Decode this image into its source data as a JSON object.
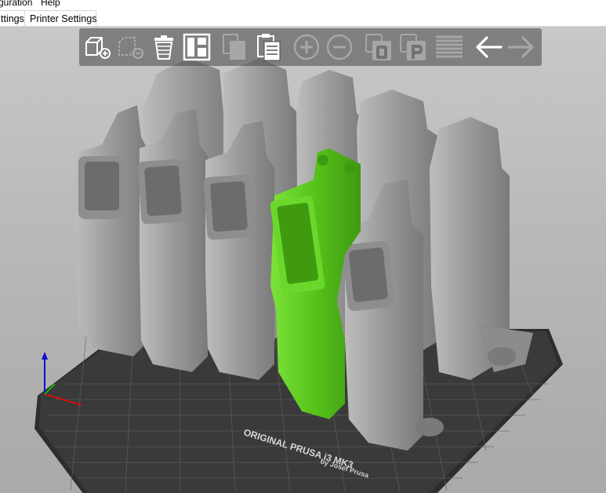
{
  "window": {
    "menu": [
      {
        "label": "guration"
      },
      {
        "label": "Help"
      }
    ]
  },
  "tabs": [
    {
      "label": "ttings"
    },
    {
      "label": "Printer Settings"
    }
  ],
  "toolbar": {
    "items": [
      {
        "icon": "add-object-icon",
        "enabled": true
      },
      {
        "icon": "delete-object-icon",
        "enabled": false
      },
      {
        "icon": "trash-icon",
        "enabled": true
      },
      {
        "icon": "arrange-icon",
        "enabled": true
      },
      {
        "icon": "copy-icon",
        "enabled": false
      },
      {
        "icon": "paste-icon",
        "enabled": true
      },
      {
        "icon": "add-instance-icon",
        "enabled": false
      },
      {
        "icon": "remove-instance-icon",
        "enabled": false
      },
      {
        "icon": "split-objects-icon",
        "enabled": false
      },
      {
        "icon": "split-parts-icon",
        "enabled": false
      },
      {
        "icon": "layers-icon",
        "enabled": false
      },
      {
        "icon": "undo-arrow-icon",
        "enabled": true
      },
      {
        "icon": "redo-arrow-icon",
        "enabled": false
      }
    ]
  },
  "bed": {
    "label_line1": "ORIGINAL PRUSA i3 MK3",
    "label_line2": "by Josef Prusa",
    "plate_color": "#3a3a3a",
    "grid_color": "#6a6a6a"
  },
  "objects": {
    "part_color": "#9b9b9b",
    "selected_color": "#56c21a"
  }
}
